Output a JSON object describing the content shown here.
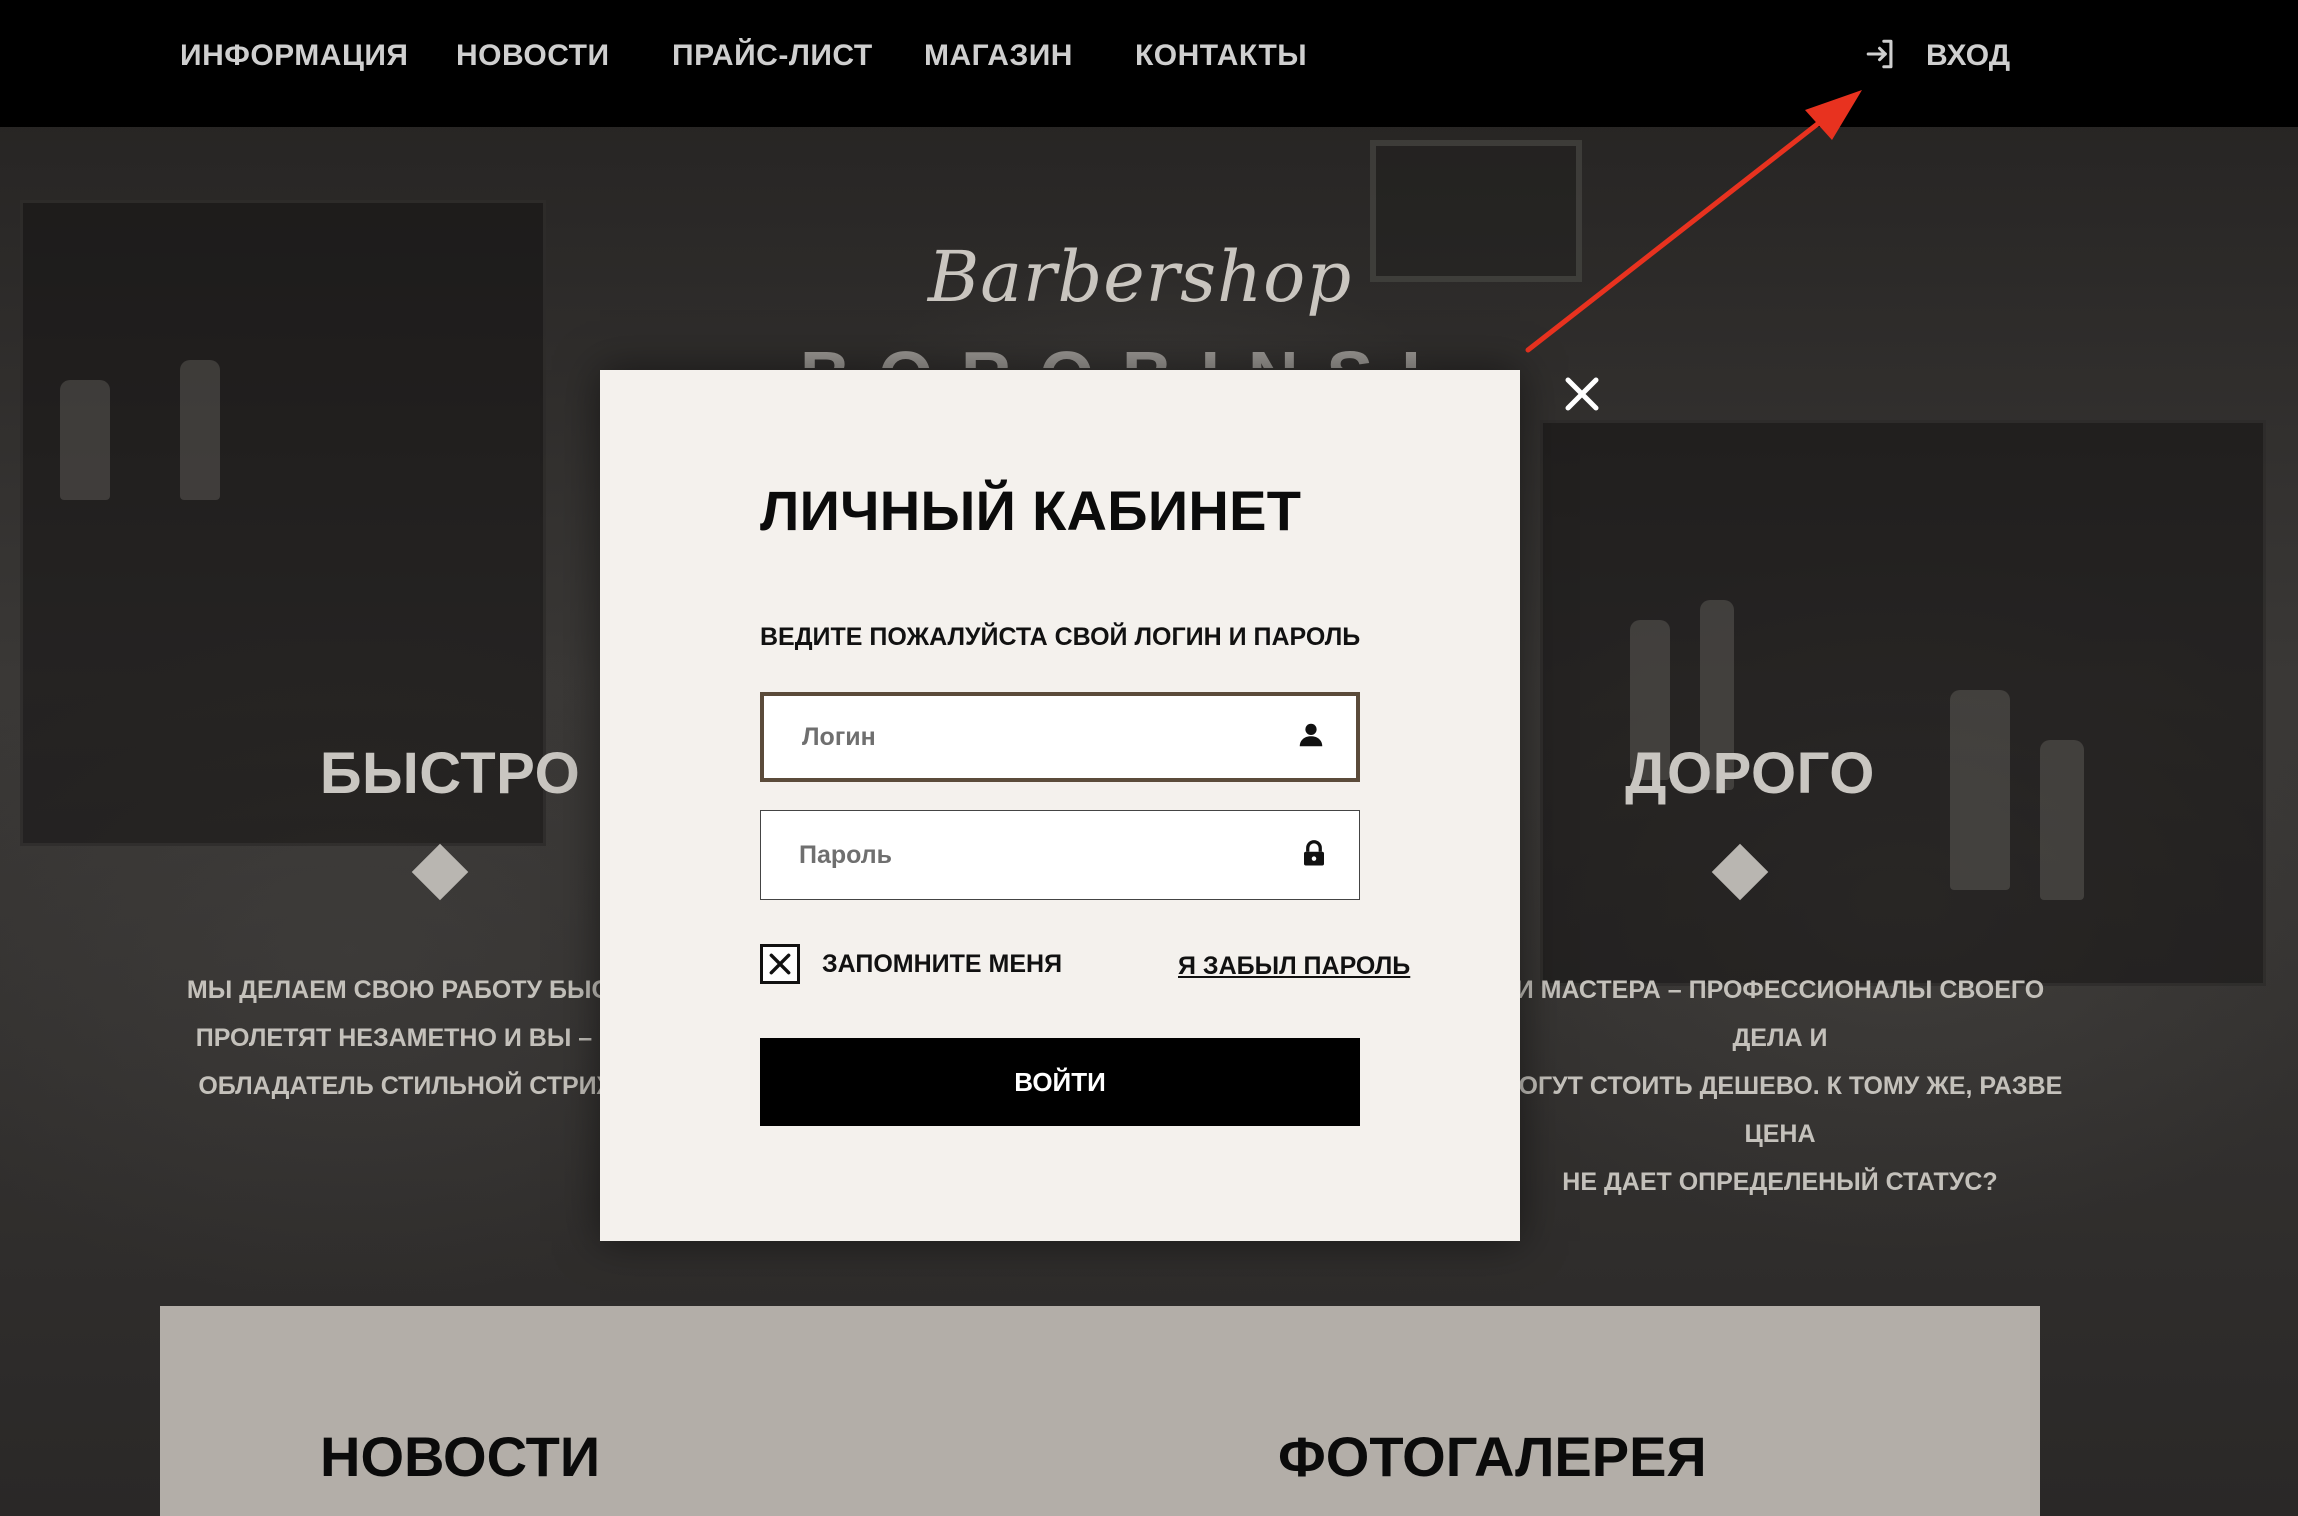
{
  "nav": {
    "items": [
      {
        "label": "ИНФОРМАЦИЯ"
      },
      {
        "label": "НОВОСТИ"
      },
      {
        "label": "ПРАЙС-ЛИСТ"
      },
      {
        "label": "МАГАЗИН"
      },
      {
        "label": "КОНТАКТЫ"
      }
    ],
    "login_label": "ВХОД"
  },
  "hero": {
    "script_title": "Barbershop",
    "brand_partial": "BOROBINSKI"
  },
  "features": [
    {
      "title": "БЫСТРО",
      "lines": [
        "МЫ ДЕЛАЕМ СВОЮ РАБОТУ БЫСТРО! Д",
        "ПРОЛЕТЯТ НЕЗАМЕТНО И ВЫ – СЧАСТ",
        "ОБЛАДАТЕЛЬ СТИЛЬНОЙ СТРИЖКИ-М"
      ]
    },
    {
      "title": "ДОРОГО",
      "lines": [
        "И МАСТЕРА – ПРОФЕССИОНАЛЫ СВОЕГО ДЕЛА И",
        "МОГУТ СТОИТЬ ДЕШЕВО. К ТОМУ ЖЕ, РАЗВЕ ЦЕНА",
        "НЕ ДАЕТ ОПРЕДЕЛЕНЫЙ СТАТУС?"
      ]
    }
  ],
  "modal": {
    "title": "ЛИЧНЫЙ КАБИНЕТ",
    "subtitle": "ВЕДИТЕ ПОЖАЛУЙСТА СВОЙ ЛОГИН И ПАРОЛЬ",
    "login_placeholder": "Логин",
    "password_placeholder": "Пароль",
    "remember_label": "ЗАПОМНИТЕ МЕНЯ",
    "remember_checked": true,
    "forgot_label": "Я ЗАБЫЛ ПАРОЛЬ",
    "submit_label": "ВОЙТИ"
  },
  "sections": {
    "news_title": "НОВОСТИ",
    "gallery_title": "ФОТОГАЛЕРЕЯ"
  },
  "colors": {
    "topbar": "#000000",
    "modal_bg": "#f4f1ed",
    "focus_border": "#5b4b3a",
    "button_bg": "#000000",
    "annotation_arrow": "#e8321f"
  },
  "icons": {
    "login": "login-icon",
    "user": "user-icon",
    "lock": "lock-icon",
    "close": "close-icon",
    "check": "check-x-icon"
  }
}
